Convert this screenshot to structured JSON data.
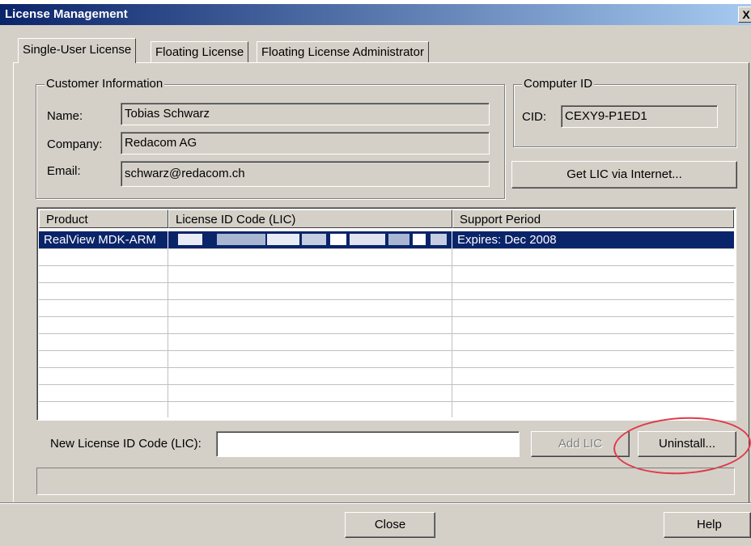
{
  "window": {
    "title": "License Management",
    "close_glyph": "X"
  },
  "tabs": [
    {
      "label": "Single-User License",
      "active": true
    },
    {
      "label": "Floating License",
      "active": false
    },
    {
      "label": "Floating License Administrator",
      "active": false
    }
  ],
  "customer": {
    "legend": "Customer Information",
    "name_label": "Name:",
    "name_value": "Tobias Schwarz",
    "company_label": "Company:",
    "company_value": "Redacom AG",
    "email_label": "Email:",
    "email_value": "schwarz@redacom.ch"
  },
  "computer": {
    "legend": "Computer ID",
    "cid_label": "CID:",
    "cid_value": "CEXY9-P1ED1",
    "get_lic_button": "Get LIC via Internet..."
  },
  "licenses": {
    "columns": [
      "Product",
      "License ID Code (LIC)",
      "Support Period"
    ],
    "rows": [
      {
        "product": "RealView MDK-ARM",
        "lic": "",
        "support": "Expires: Dec 2008",
        "selected": true
      }
    ]
  },
  "new_lic": {
    "label": "New License ID Code (LIC):",
    "value": "",
    "add_button": "Add LIC",
    "add_enabled": false,
    "uninstall_button": "Uninstall..."
  },
  "footer": {
    "close_button": "Close",
    "help_button": "Help"
  },
  "colors": {
    "annotation": "#e03a4a",
    "selection": "#0a246a",
    "title_gradient_start": "#0a246a"
  }
}
